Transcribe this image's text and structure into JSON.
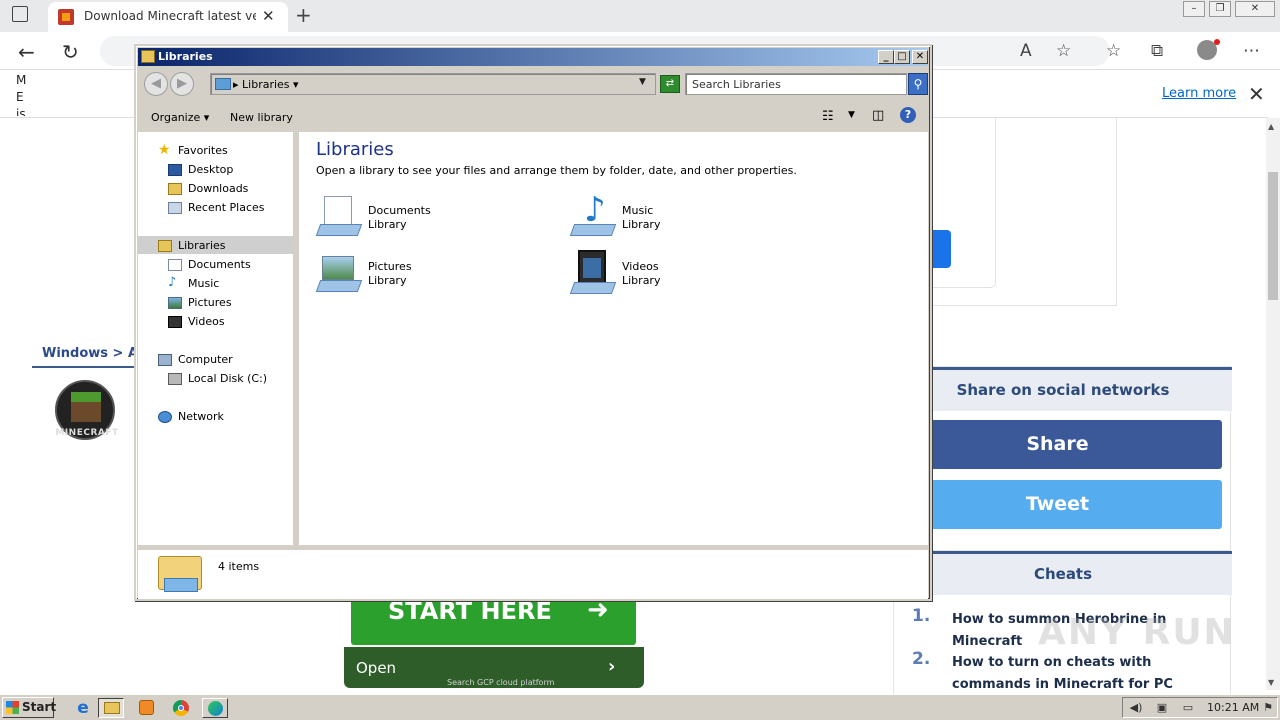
{
  "browser": {
    "tab_title": "Download Minecraft latest versio",
    "window_controls": [
      "–",
      "❐",
      "✕"
    ],
    "info_text": "M E is",
    "learn_more": "Learn more"
  },
  "page": {
    "breadcrumb": "Windows > Adv",
    "logo_text": "MINECRAFT",
    "share_heading": "Share on social networks",
    "share_label": "Share",
    "tweet_label": "Tweet",
    "cheats_heading": "Cheats",
    "cheats": [
      {
        "num": "1.",
        "text": "How to summon Herobrine in Minecraft"
      },
      {
        "num": "2.",
        "text": "How to turn on cheats with commands in Minecraft for PC"
      }
    ],
    "start_here": "START HERE",
    "open_label": "Open",
    "gcp_text": "Search GCP cloud platform",
    "watermark": "ANY RUN"
  },
  "explorer": {
    "title": "Libraries",
    "address_crumb": "Libraries",
    "search_placeholder": "Search Libraries",
    "commands": {
      "organize": "Organize",
      "new_library": "New library"
    },
    "nav": {
      "favorites": "Favorites",
      "desktop": "Desktop",
      "downloads": "Downloads",
      "recent": "Recent Places",
      "libraries": "Libraries",
      "documents": "Documents",
      "music": "Music",
      "pictures": "Pictures",
      "videos": "Videos",
      "computer": "Computer",
      "local_disk": "Local Disk (C:)",
      "network": "Network"
    },
    "heading": "Libraries",
    "subheading": "Open a library to see your files and arrange them by folder, date, and other properties.",
    "libraries": [
      {
        "name": "Documents",
        "type": "Library"
      },
      {
        "name": "Music",
        "type": "Library"
      },
      {
        "name": "Pictures",
        "type": "Library"
      },
      {
        "name": "Videos",
        "type": "Library"
      }
    ],
    "item_count": "4 items"
  },
  "taskbar": {
    "start_label": "Start",
    "clock": "10:21 AM"
  },
  "colors": {
    "share_blue": "#3b5998",
    "tweet_blue": "#55acee",
    "start_green": "#2ca02c",
    "title_gradient_start": "#0a246a"
  }
}
